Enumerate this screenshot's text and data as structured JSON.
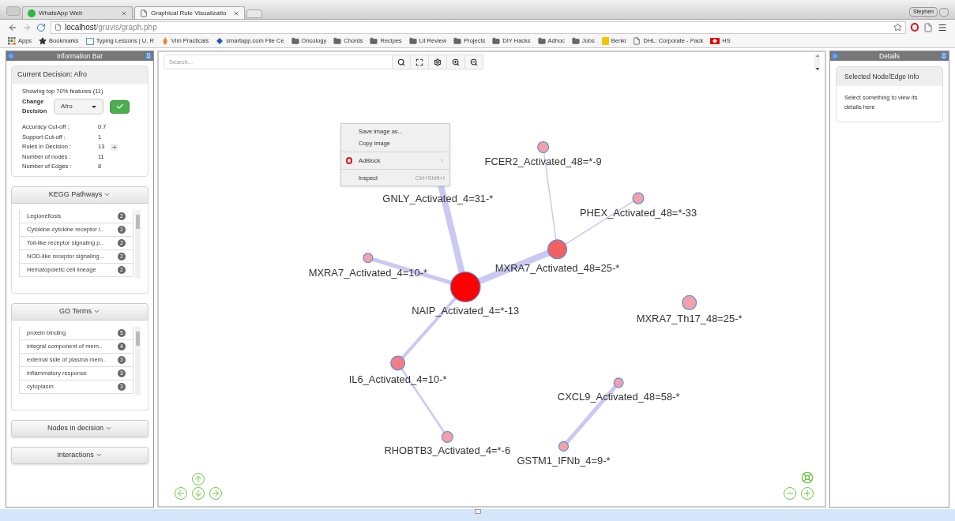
{
  "browser": {
    "tabs": [
      {
        "title": "WhatsApp Web",
        "kind": "whatsapp",
        "selected": false
      },
      {
        "title": "Graphical Rule Visualizatio",
        "kind": "page",
        "selected": true
      }
    ],
    "profile": "Stephen",
    "address": {
      "host": "localhost",
      "path": "/gruvis/graph.php"
    },
    "bookmarks": [
      {
        "label": "Apps",
        "kind": "apps"
      },
      {
        "label": "Bookmarks",
        "kind": "star"
      },
      {
        "label": "Typing Lessons | U, R",
        "kind": "site"
      },
      {
        "label": "Vim Practicals",
        "kind": "vim"
      },
      {
        "label": "smartapp.com File Ce",
        "kind": "smart"
      },
      {
        "label": "Oncology",
        "kind": "folder"
      },
      {
        "label": "Chords",
        "kind": "folder"
      },
      {
        "label": "Recipes",
        "kind": "folder"
      },
      {
        "label": "Lit Review",
        "kind": "folder"
      },
      {
        "label": "Projects",
        "kind": "folder"
      },
      {
        "label": "DIY Hacks",
        "kind": "folder"
      },
      {
        "label": "Adhoc",
        "kind": "folder"
      },
      {
        "label": "Jobs",
        "kind": "folder"
      },
      {
        "label": "Benki",
        "kind": "benki"
      },
      {
        "label": "DHL: Corporate - Pack",
        "kind": "page"
      },
      {
        "label": "HS",
        "kind": "hs"
      }
    ]
  },
  "info_bar": {
    "title": "Information Bar",
    "decision": {
      "title": "Current Decision: Afro",
      "subtitle": "Showing top 70% features (11)",
      "change_label": "Change Decision",
      "select_value": "Afro",
      "stats": [
        {
          "label": "Accuracy Cut-off :",
          "value": "0.7",
          "kind": "plain"
        },
        {
          "label": "Support Cut-off :",
          "value": "1",
          "kind": "plain"
        },
        {
          "label": "Rules in Decision :",
          "value": "13",
          "kind": "link"
        },
        {
          "label": "Number of nodes :",
          "value": "11",
          "kind": "plain"
        },
        {
          "label": "Number of Edges :",
          "value": "8",
          "kind": "plain"
        }
      ]
    },
    "sections": [
      {
        "title": "KEGG Pathways",
        "expanded": true,
        "items": [
          {
            "label": "Legionellosis",
            "count": "2"
          },
          {
            "label": "Cytokine-cytokine receptor i..",
            "count": "2"
          },
          {
            "label": "Toll-like receptor signaling p..",
            "count": "2"
          },
          {
            "label": "NOD-like receptor signaling ..",
            "count": "2"
          },
          {
            "label": "Hematopoietic cell lineage",
            "count": "2"
          }
        ]
      },
      {
        "title": "GO Terms",
        "expanded": true,
        "items": [
          {
            "label": "protein binding",
            "count": "5"
          },
          {
            "label": "integral component of mem..",
            "count": "4"
          },
          {
            "label": "external side of plasma mem..",
            "count": "3"
          },
          {
            "label": "inflammatory response",
            "count": "3"
          },
          {
            "label": "cytoplasm",
            "count": "3"
          }
        ]
      },
      {
        "title": "Nodes in decision",
        "expanded": false
      },
      {
        "title": "Interactions",
        "expanded": false
      }
    ]
  },
  "canvas": {
    "search": {
      "placeholder": "Search..."
    },
    "nodes": [
      {
        "label": "FCER2_Activated_48=*-9",
        "color": "#f4a0a8"
      },
      {
        "label": "GNLY_Activated_4=31-*"
      },
      {
        "label": "PHEX_Activated_48=*-33",
        "color": "#f4a0a8"
      },
      {
        "label": "MXRA7_Activated_48=25-*",
        "color": "#f26161"
      },
      {
        "label": "MXRA7_Activated_4=10-*",
        "color": "#f4a0a8"
      },
      {
        "label": "NAIP_Activated_4=*-13",
        "color": "#ff0000"
      },
      {
        "label": "MXRA7_Th17_48=25-*",
        "color": "#f4a0a8"
      },
      {
        "label": "IL6_Activated_4=10-*",
        "color": "#f07e86"
      },
      {
        "label": "CXCL9_Activated_48=58-*",
        "color": "#f4a0a8"
      },
      {
        "label": "RHOBTB3_Activated_4=*-6",
        "color": "#f4a0a8"
      },
      {
        "label": "GSTM1_IFNb_4=9-*",
        "color": "#f4a0a8"
      }
    ],
    "context_menu": [
      {
        "label": "Save image as...",
        "kind": "item"
      },
      {
        "label": "Copy image",
        "kind": "item"
      },
      {
        "label": "AdBlock",
        "kind": "submenu"
      },
      {
        "label": "Inspect",
        "kind": "item",
        "shortcut": "Ctrl+Shift+I"
      }
    ]
  },
  "details": {
    "title": "Details",
    "card_title": "Selected Node/Edge Info",
    "text": "Select something to view its details here"
  }
}
